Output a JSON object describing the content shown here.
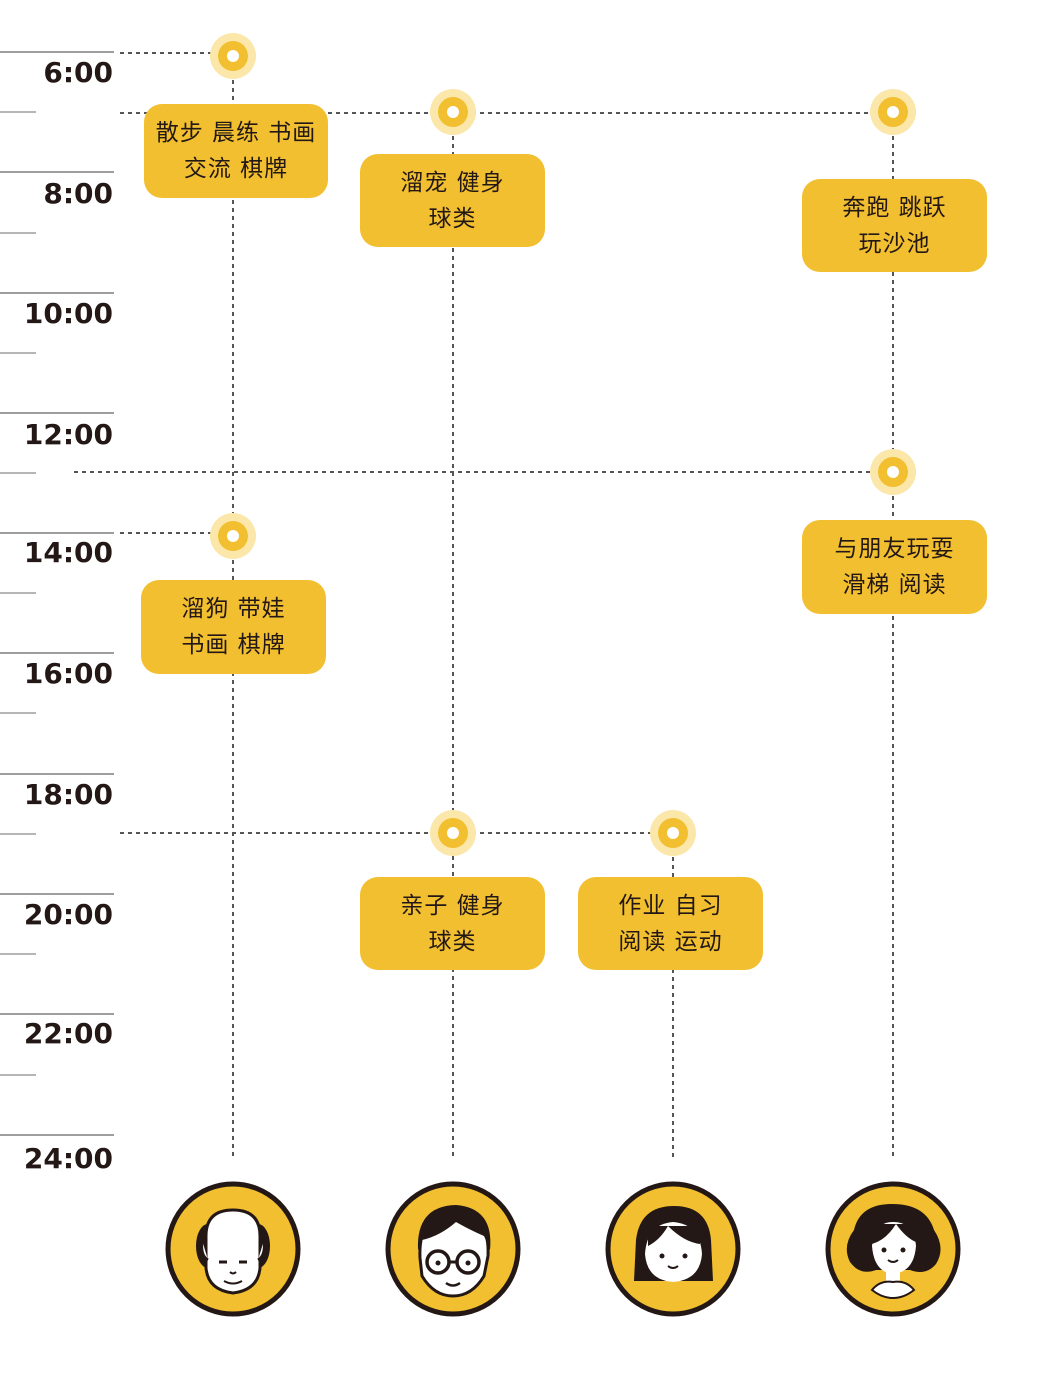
{
  "colors": {
    "accent": "#F2BF30",
    "accent_light": "#FBE7A9",
    "ink": "#231815",
    "tick": "#9E9E9E",
    "dash": "#555555"
  },
  "time_labels": [
    "6:00",
    "8:00",
    "10:00",
    "12:00",
    "14:00",
    "16:00",
    "18:00",
    "20:00",
    "22:00",
    "24:00"
  ],
  "activities": [
    {
      "lines": [
        "散步 晨练 书画",
        "交流  棋牌"
      ]
    },
    {
      "lines": [
        "溜宠  健身",
        "球类"
      ]
    },
    {
      "lines": [
        "奔跑  跳跃",
        "玩沙池"
      ]
    },
    {
      "lines": [
        "与朋友玩耍",
        "滑梯  阅读"
      ]
    },
    {
      "lines": [
        "溜狗  带娃",
        "书画  棋牌"
      ]
    },
    {
      "lines": [
        "亲子  健身",
        "球类"
      ]
    },
    {
      "lines": [
        "作业  自习",
        "阅读  运动"
      ]
    }
  ],
  "persons": [
    {
      "icon": "elderly-man-icon"
    },
    {
      "icon": "man-with-glasses-icon"
    },
    {
      "icon": "girl-icon"
    },
    {
      "icon": "woman-icon"
    }
  ]
}
